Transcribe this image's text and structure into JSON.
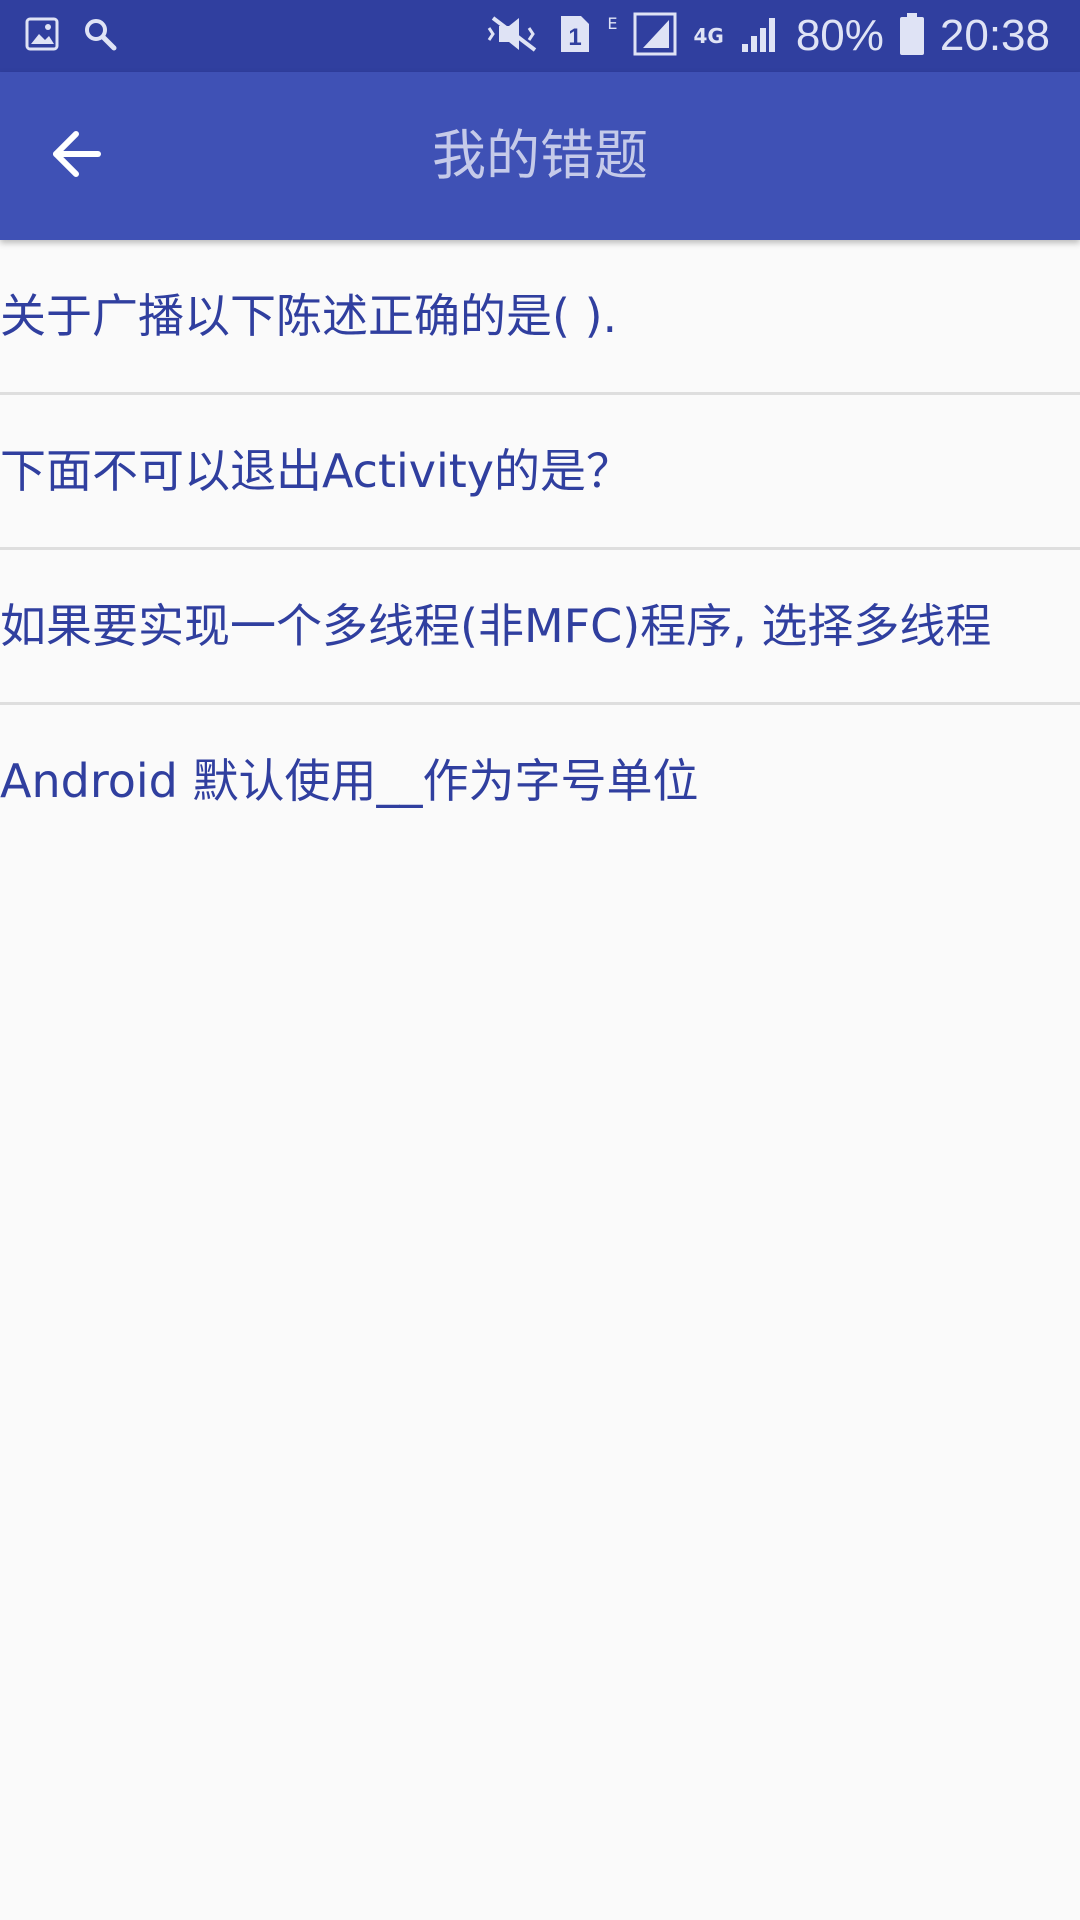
{
  "status_bar": {
    "battery": "80%",
    "time": "20:38",
    "sim_label": "1",
    "network_e": "E",
    "network_4g": "4G"
  },
  "app_bar": {
    "title": "我的错题",
    "back_icon": "arrow-back-icon"
  },
  "questions": [
    {
      "text": "关于广播以下陈述正确的是( )."
    },
    {
      "text": "下面不可以退出Activity的是？"
    },
    {
      "text": "如果要实现一个多线程(非MFC)程序, 选择多线程"
    },
    {
      "text": "Android 默认使用__作为字号单位"
    }
  ],
  "colors": {
    "status_bar": "#303f9f",
    "app_bar": "#3f51b5",
    "list_text": "#303f9f",
    "background": "#fafafa"
  }
}
